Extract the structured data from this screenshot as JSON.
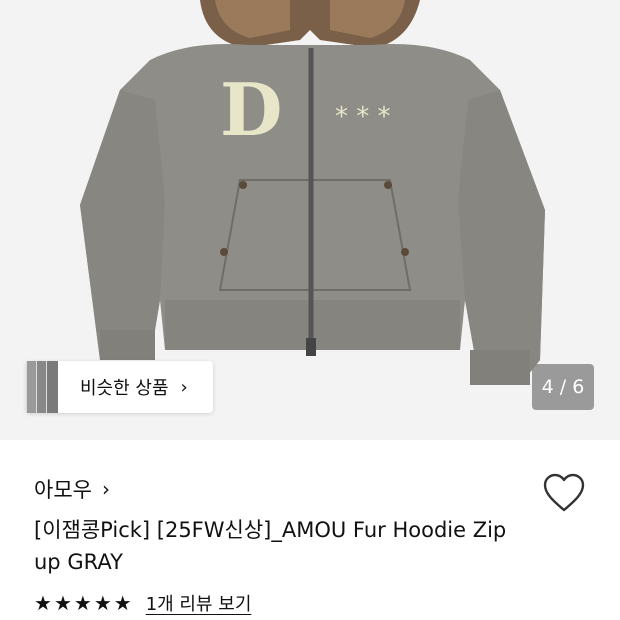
{
  "gallery": {
    "similar_label": "비슷한 상품",
    "similar_chevron": "›",
    "counter": "4 / 6",
    "photo_icon": "hoodie-photo",
    "print_stars": "* * *"
  },
  "product": {
    "brand": "아모우",
    "brand_chevron": "›",
    "title": "[이잼콩Pick] [25FW신상]_AMOU Fur Hoodie Zip up GRAY",
    "wishlist_icon": "heart-outline-icon",
    "rating": 5,
    "stars": [
      "★",
      "★",
      "★",
      "★",
      "★"
    ],
    "review_link": "1개 리뷰 보기"
  }
}
